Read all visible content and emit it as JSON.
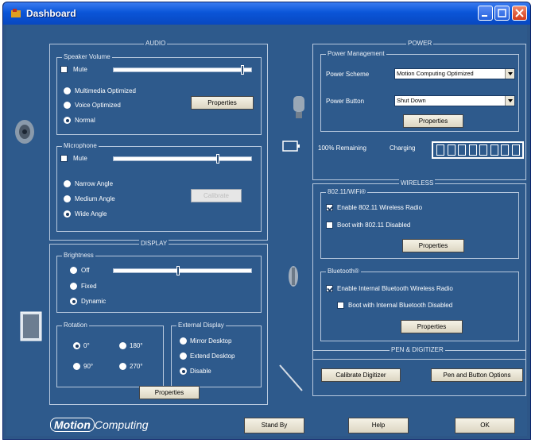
{
  "window": {
    "title": "Dashboard"
  },
  "audio": {
    "group_title": "AUDIO",
    "speaker": {
      "title": "Speaker Volume",
      "mute_label": "Mute",
      "mute_checked": false,
      "volume_level": 0.95,
      "modes": [
        "Multimedia Optimized",
        "Voice Optimized",
        "Normal"
      ],
      "selected_mode": "Normal",
      "properties_label": "Properties"
    },
    "microphone": {
      "title": "Microphone",
      "mute_label": "Mute",
      "mute_checked": false,
      "level": 0.75,
      "modes": [
        "Narrow Angle",
        "Medium Angle",
        "Wide Angle"
      ],
      "selected_mode": "Wide Angle",
      "calibrate_label": "Calibrate"
    }
  },
  "display": {
    "group_title": "DISPLAY",
    "brightness": {
      "title": "Brightness",
      "level": 0.45,
      "modes": [
        "Off",
        "Fixed",
        "Dynamic"
      ],
      "selected_mode": "Dynamic"
    },
    "rotation": {
      "title": "Rotation",
      "options": [
        "0°",
        "180°",
        "90°",
        "270°"
      ],
      "selected": "0°"
    },
    "external": {
      "title": "External Display",
      "options": [
        "Mirror Desktop",
        "Extend Desktop",
        "Disable"
      ],
      "selected": "Disable"
    },
    "properties_label": "Properties"
  },
  "power": {
    "group_title": "POWER",
    "management_title": "Power Management",
    "scheme_label": "Power Scheme",
    "scheme_value": "Motion Computing Optimized",
    "button_label": "Power Button",
    "button_value": "Shut Down",
    "properties_label": "Properties",
    "remaining_label": "100% Remaining",
    "charging_label": "Charging",
    "battery_level": 1.0
  },
  "wireless": {
    "group_title": "WIRELESS",
    "wifi": {
      "title": "802.11/WiFi®",
      "enable_label": "Enable 802.11 Wireless Radio",
      "enable_checked": true,
      "boot_label": "Boot with 802.11 Disabled",
      "boot_checked": false,
      "properties_label": "Properties"
    },
    "bluetooth": {
      "title": "Bluetooth®",
      "enable_label": "Enable Internal Bluetooth Wireless Radio",
      "enable_checked": true,
      "boot_label": "Boot with Internal Bluetooth Disabled",
      "boot_checked": false,
      "properties_label": "Properties"
    }
  },
  "pen": {
    "group_title": "PEN & DIGITIZER",
    "calibrate_label": "Calibrate Digitizer",
    "options_label": "Pen and Button Options"
  },
  "footer": {
    "logo_brand": "Motion",
    "logo_rest": "Computing",
    "standby_label": "Stand By",
    "help_label": "Help",
    "ok_label": "OK"
  },
  "icons": [
    "speaker-icon",
    "microphone-icon",
    "monitor-icon",
    "battery-icon",
    "wifi-antenna-icon",
    "pen-icon"
  ],
  "colors": {
    "background": "#2e5a8c",
    "titlebar": "#0a55d8",
    "button": "#ece9d8"
  }
}
